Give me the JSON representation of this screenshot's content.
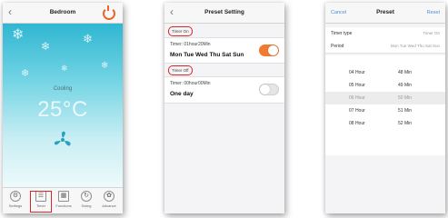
{
  "phone1": {
    "title": "Bedroom",
    "back": "‹",
    "mode": "Cooling",
    "temperature": "25°C",
    "colors": {
      "sky_top": "#2fb6d2",
      "power": "#e8672a",
      "highlight": "#d8262a"
    },
    "tabs": [
      {
        "label": "Settings",
        "icon": "gear-icon"
      },
      {
        "label": "Timer",
        "icon": "timer-icon",
        "active": true
      },
      {
        "label": "Functions",
        "icon": "functions-icon"
      },
      {
        "label": "Swing",
        "icon": "swing-icon"
      },
      {
        "label": "Advance",
        "icon": "advance-icon"
      }
    ]
  },
  "phone2": {
    "title": "Preset Setting",
    "back": "‹",
    "group1_label": "Timer On",
    "group1_line1": "Timer: 01hour20Min",
    "group1_days": "Mon Tue Wed Thu Sat Sun",
    "group1_on": true,
    "group2_label": "Timer Off",
    "group2_line1": "Timer: 00hour00Min",
    "group2_days": "One day",
    "group2_on": false
  },
  "phone3": {
    "cancel": "Cancel",
    "title": "Preset",
    "reset": "Reset",
    "timer_type_label": "Timer type",
    "timer_type_value": "Timer On",
    "period_label": "Period",
    "period_value": "Mon Tue Wed Thu Sat Sun",
    "rows": [
      {
        "hour": "04 Hour",
        "min": "48 Min"
      },
      {
        "hour": "05 Hour",
        "min": "49 Min"
      },
      {
        "hour": "06 Hour",
        "min": "50 Min"
      },
      {
        "hour": "07 Hour",
        "min": "51 Min"
      },
      {
        "hour": "08 Hour",
        "min": "52 Min"
      }
    ]
  }
}
